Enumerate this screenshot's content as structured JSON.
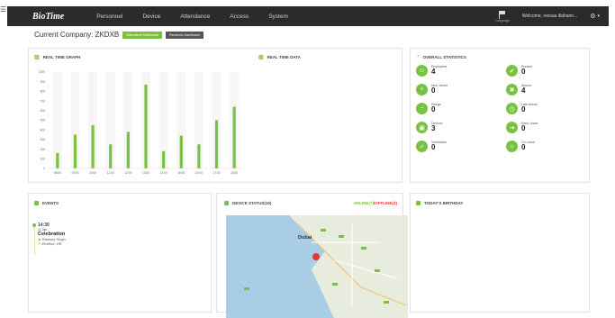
{
  "app": {
    "logo": "BioTime",
    "nav": [
      "Personnel",
      "Device",
      "Attendance",
      "Access",
      "System"
    ],
    "language_label": "Language",
    "welcome": "Welcome, ressaa illahann..."
  },
  "company": {
    "label": "Current Company: ZKDXB",
    "attendance_dashboard": "Attendance Dashboard",
    "pandemic_dashboard": "Pandemic Dashboard"
  },
  "panels": {
    "realtime_graph": "REAL TIME GRAPH",
    "realtime_data": "REAL TIME DATA",
    "overall_stats": "OVERALL STATISTICS",
    "events": "EVENTS",
    "device_status": "DEVICE STATUS(10)",
    "birthday": "TODAY'S BIRTHDAY"
  },
  "device_status": {
    "online": "ONLINE(7)",
    "separator": "/",
    "offline": "OFFLINE(3)"
  },
  "chart_data": {
    "type": "bar",
    "categories": [
      "08:00",
      "09:00",
      "10:00",
      "11:00",
      "12:00",
      "13:00",
      "14:00",
      "15:00",
      "16:00",
      "17:00",
      "18:00"
    ],
    "values": [
      160,
      350,
      450,
      250,
      380,
      870,
      180,
      340,
      250,
      500,
      640
    ],
    "ylim": [
      0,
      1000
    ],
    "yticks": [
      0,
      100,
      200,
      300,
      400,
      500,
      600,
      700,
      800,
      900,
      1000
    ],
    "color": "#7ac143",
    "grid": false
  },
  "stats": [
    {
      "label": "Employees",
      "value": "4",
      "icon": "employees-icon",
      "glyph": "☺"
    },
    {
      "label": "Present",
      "value": "0",
      "icon": "present-icon",
      "glyph": "✔"
    },
    {
      "label": "New Joinee",
      "value": "0",
      "icon": "new-joinee-icon",
      "glyph": "+"
    },
    {
      "label": "Absent",
      "value": "4",
      "icon": "absent-icon",
      "glyph": "✖"
    },
    {
      "label": "Resign",
      "value": "0",
      "icon": "resign-icon",
      "glyph": "−"
    },
    {
      "label": "Late Arrival",
      "value": "0",
      "icon": "late-arrival-icon",
      "glyph": "◷"
    },
    {
      "label": "Devices",
      "value": "3",
      "icon": "devices-icon",
      "glyph": "▣"
    },
    {
      "label": "Early Leave",
      "value": "0",
      "icon": "early-leave-icon",
      "glyph": "⇥"
    },
    {
      "label": "Verification",
      "value": "0",
      "icon": "verification-icon",
      "glyph": "✓"
    },
    {
      "label": "On Leave",
      "value": "0",
      "icon": "on-leave-icon",
      "glyph": "☼"
    }
  ],
  "event": {
    "time": "14:30",
    "date": "11 Jan",
    "title": "Celebration",
    "person": "Ramsey Singh",
    "location": "ZKoffice, HR"
  },
  "map": {
    "city": "Dubai"
  }
}
